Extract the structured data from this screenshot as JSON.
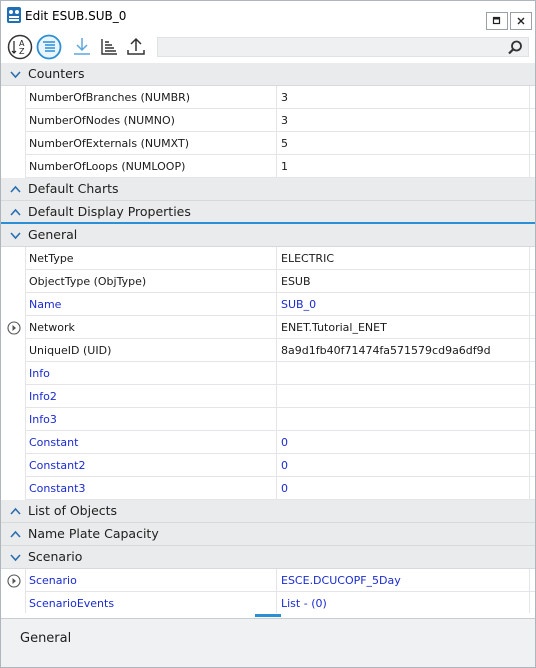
{
  "window": {
    "title": "Edit ESUB.SUB_0",
    "restore_symbol": "□",
    "close_symbol": "×"
  },
  "toolbar": {
    "search": {
      "value": "",
      "placeholder": ""
    },
    "tools": [
      {
        "icon": "sort-alphabetical-icon"
      },
      {
        "icon": "categorized-icon",
        "active": true
      },
      {
        "icon": "download-icon"
      },
      {
        "icon": "sort-columns-icon"
      },
      {
        "icon": "upload-icon"
      }
    ]
  },
  "colors": {
    "accent": "#2b8fd6",
    "editable_text": "#1a2bd0",
    "category_bg": "#eaebec"
  },
  "categories": {
    "counters": {
      "label": "Counters",
      "props": [
        {
          "name": "NumberOfBranches (NUMBR)",
          "value": "3"
        },
        {
          "name": "NumberOfNodes (NUMNO)",
          "value": "3"
        },
        {
          "name": "NumberOfExternals (NUMXT)",
          "value": "5"
        },
        {
          "name": "NumberOfLoops (NUMLOOP)",
          "value": "1"
        }
      ]
    },
    "default_charts": {
      "label": "Default Charts"
    },
    "default_display": {
      "label": "Default Display Properties"
    },
    "general": {
      "label": "General",
      "props": [
        {
          "name": "NetType",
          "value": "ELECTRIC"
        },
        {
          "name": "ObjectType (ObjType)",
          "value": "ESUB"
        },
        {
          "name": "Name",
          "value": "SUB_0"
        },
        {
          "name": "Network",
          "value": "ENET.Tutorial_ENET"
        },
        {
          "name": "UniqueID (UID)",
          "value": "8a9d1fb40f71474fa571579cd9a6df9d"
        },
        {
          "name": "Info",
          "value": ""
        },
        {
          "name": "Info2",
          "value": ""
        },
        {
          "name": "Info3",
          "value": ""
        },
        {
          "name": "Constant",
          "value": "0"
        },
        {
          "name": "Constant2",
          "value": "0"
        },
        {
          "name": "Constant3",
          "value": "0"
        }
      ]
    },
    "list_of_objects": {
      "label": "List of Objects"
    },
    "name_plate": {
      "label": "Name Plate Capacity"
    },
    "scenario": {
      "label": "Scenario",
      "props": [
        {
          "name": "Scenario",
          "value": "ESCE.DCUCOPF_5Day"
        },
        {
          "name": "ScenarioEvents",
          "value": "List - (0)"
        }
      ]
    }
  },
  "description": {
    "title": "General"
  }
}
